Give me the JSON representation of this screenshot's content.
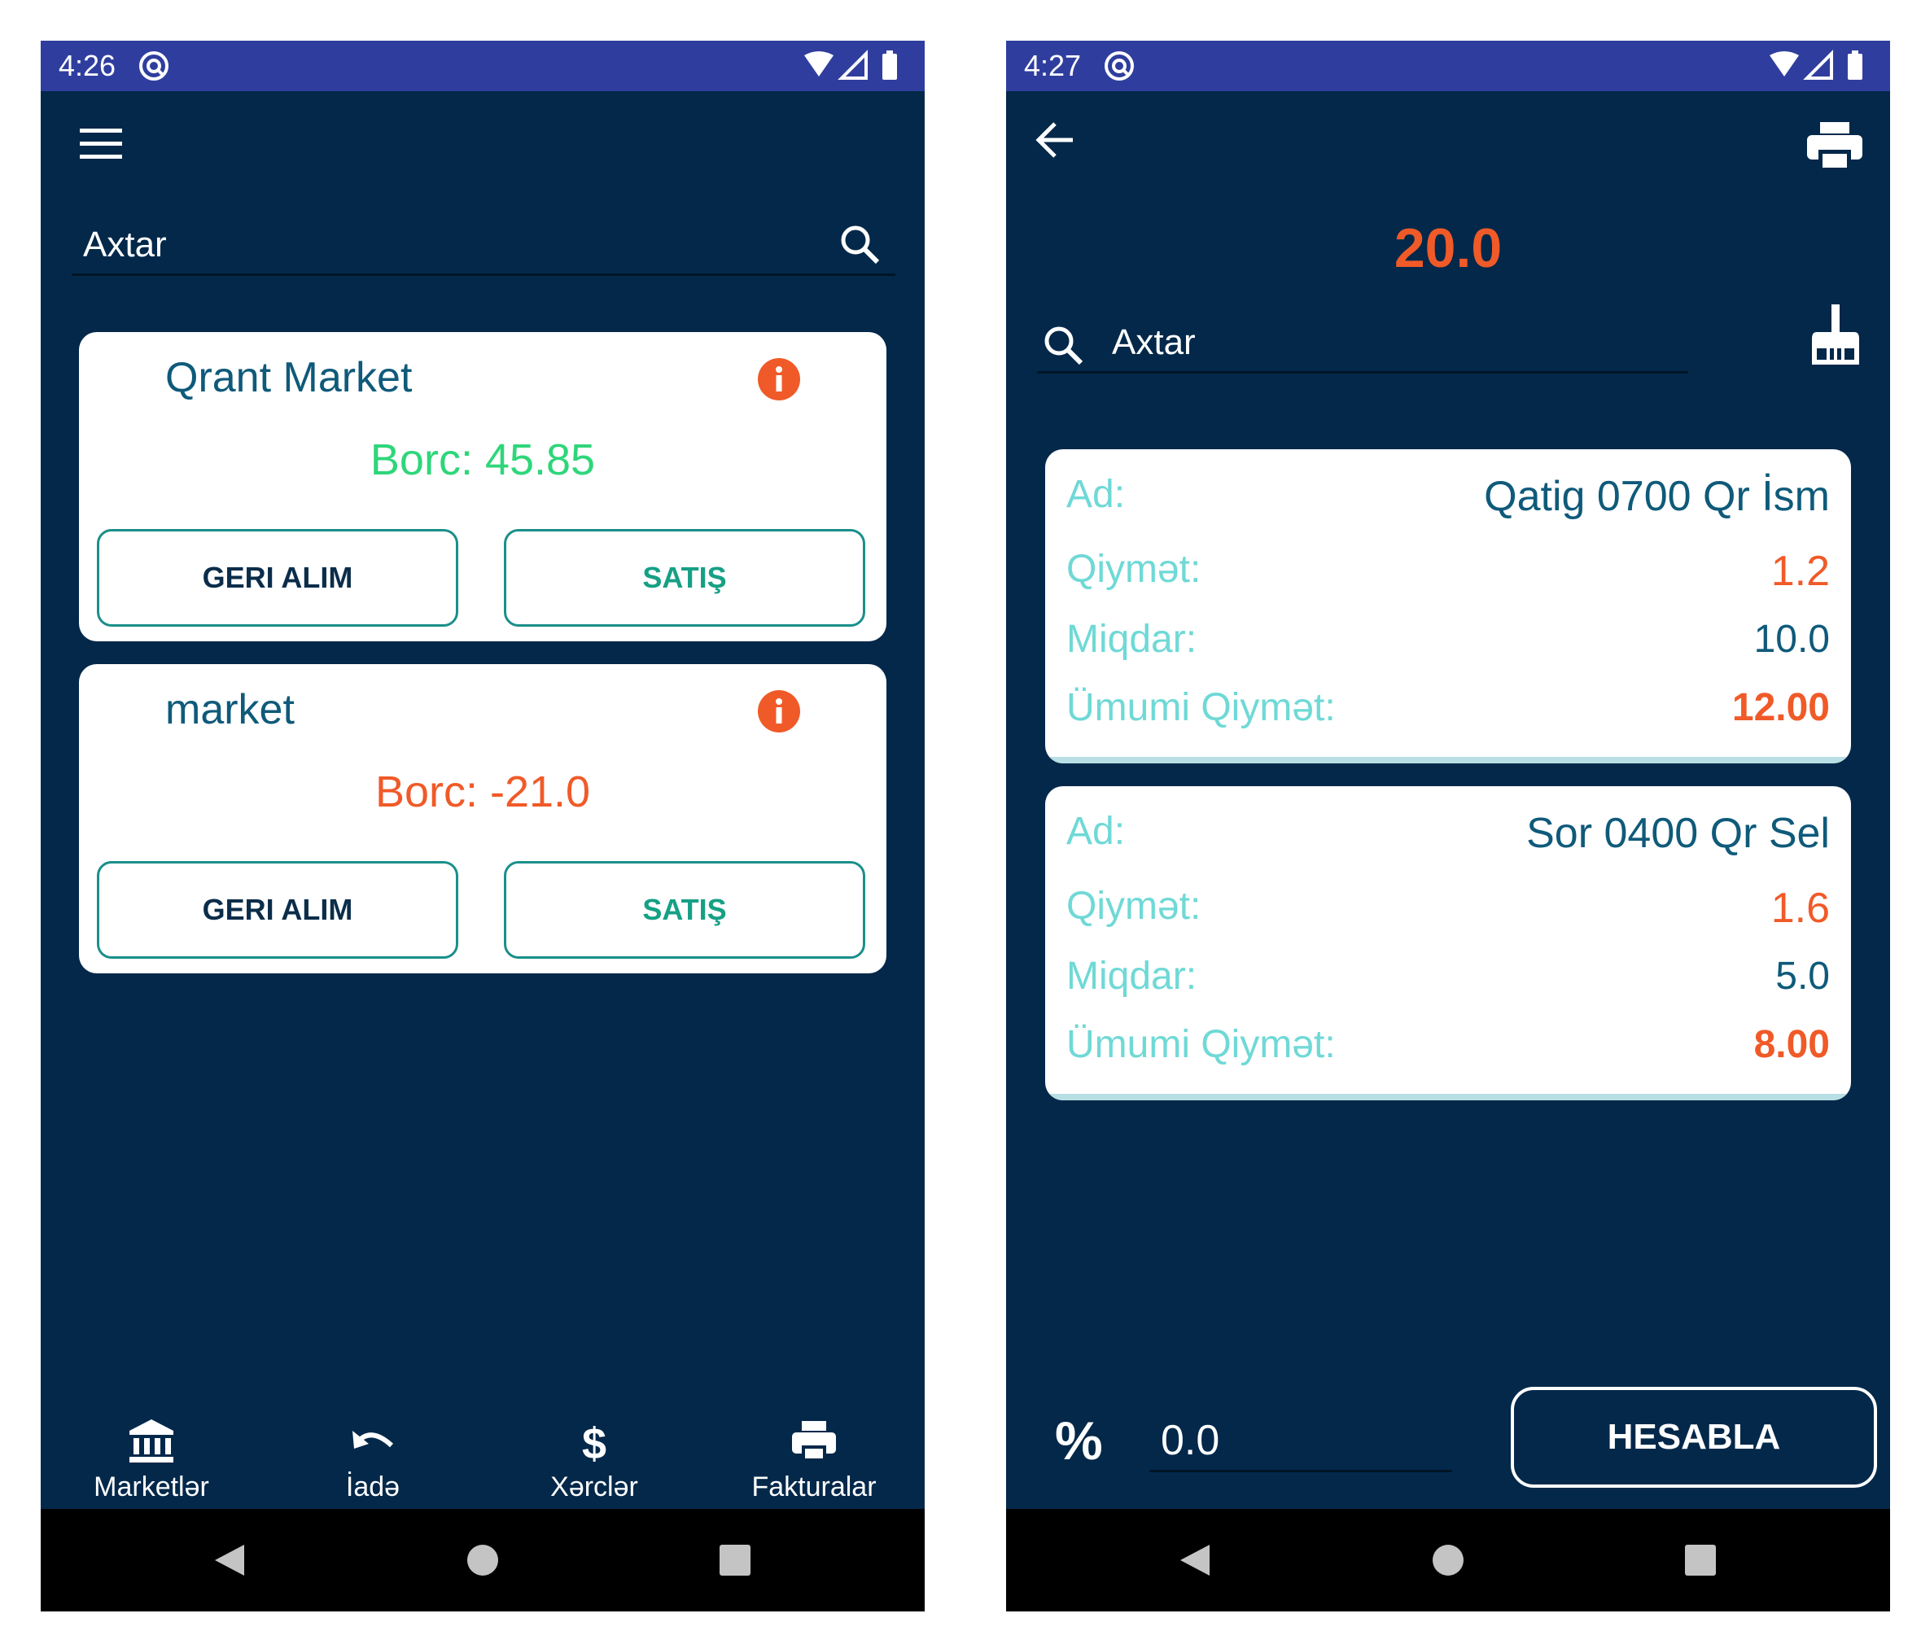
{
  "left": {
    "status": {
      "time": "4:26"
    },
    "search": {
      "placeholder": "Axtar"
    },
    "markets": [
      {
        "name": "Qrant Market",
        "debt": "Borc: 45.85",
        "debt_color": "#2ed67a",
        "btn_left": "GERI ALIM",
        "btn_right": "SATIŞ"
      },
      {
        "name": "market",
        "debt": "Borc: -21.0",
        "debt_color": "#f05a28",
        "btn_left": "GERI ALIM",
        "btn_right": "SATIŞ"
      }
    ],
    "bottom_nav": [
      {
        "label": "Marketlər",
        "icon": "bank-icon"
      },
      {
        "label": "İadə",
        "icon": "undo-icon"
      },
      {
        "label": "Xərclər",
        "icon": "dollar-icon"
      },
      {
        "label": "Fakturalar",
        "icon": "print-icon"
      }
    ]
  },
  "right": {
    "status": {
      "time": "4:27"
    },
    "total": "20.0",
    "search": {
      "placeholder": "Axtar"
    },
    "labels": {
      "name": "Ad:",
      "price": "Qiymət:",
      "qty": "Miqdar:",
      "total": "Ümumi Qiymət:"
    },
    "products": [
      {
        "name": "Qatig 0700 Qr İsm",
        "price": "1.2",
        "qty": "10.0",
        "total": "12.00"
      },
      {
        "name": "Sor 0400 Qr Sel",
        "price": "1.6",
        "qty": "5.0",
        "total": "8.00"
      }
    ],
    "discount": {
      "symbol": "%",
      "value": "0.0"
    },
    "calculate_label": "HESABLA"
  },
  "colors": {
    "background": "#03284a",
    "statusbar": "#2f3e9e",
    "accent_orange": "#f05a28",
    "teal": "#1a8f8a",
    "label_cyan": "#6fd9d6"
  }
}
